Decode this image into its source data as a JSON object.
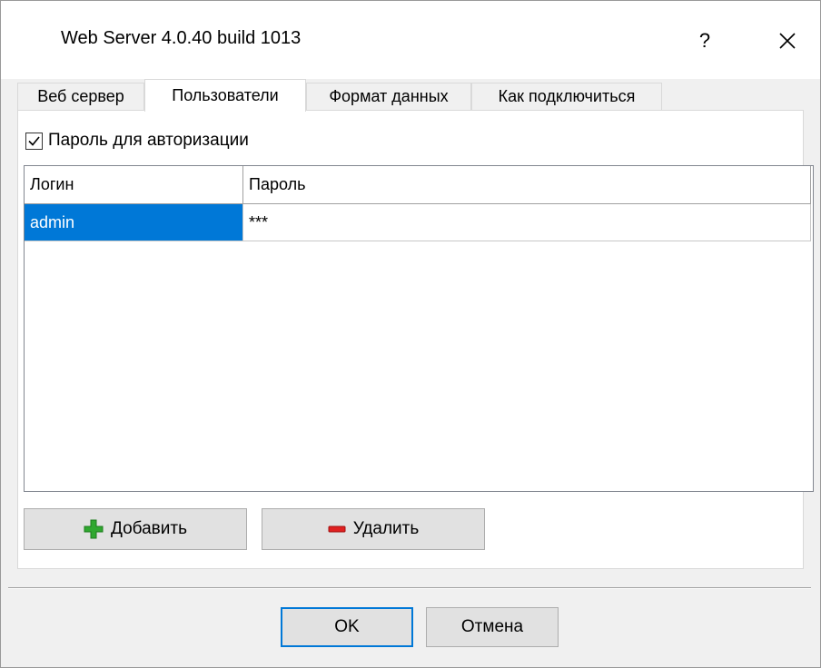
{
  "window": {
    "title": "Web Server 4.0.40 build 1013",
    "help_label": "?",
    "close_icon": "close-icon"
  },
  "tabs": [
    {
      "label": "Веб сервер",
      "active": false
    },
    {
      "label": "Пользователи",
      "active": true
    },
    {
      "label": "Формат данных",
      "active": false
    },
    {
      "label": "Как подключиться",
      "active": false
    }
  ],
  "users_panel": {
    "auth_checkbox": {
      "label": "Пароль для авторизации",
      "checked": true
    },
    "grid": {
      "columns": [
        "Логин",
        "Пароль"
      ],
      "rows": [
        {
          "login": "admin",
          "password": "***",
          "selected": true
        }
      ]
    },
    "add_button": {
      "label": "Добавить",
      "icon": "plus-icon"
    },
    "delete_button": {
      "label": "Удалить",
      "icon": "minus-icon"
    }
  },
  "footer": {
    "ok_label": "OK",
    "cancel_label": "Отмена"
  },
  "colors": {
    "accent": "#0078d7",
    "plus_green": "#2fa82f",
    "minus_red": "#e02020"
  }
}
